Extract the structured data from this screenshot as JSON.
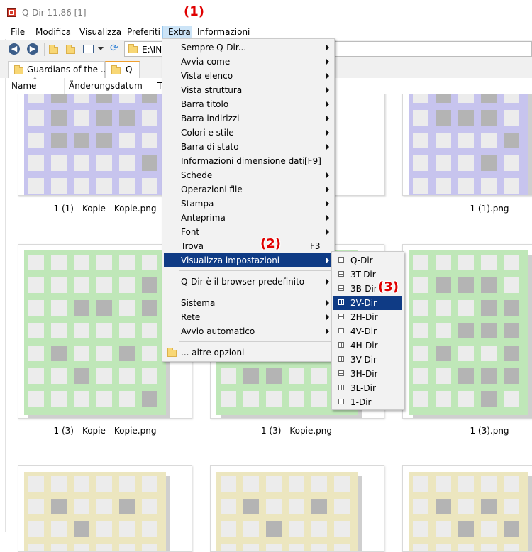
{
  "window": {
    "title": "Q-Dir 11.86 [1]"
  },
  "menubar": {
    "items": [
      "File",
      "Modifica",
      "Visualizza",
      "Preferiti",
      "Extra",
      "Informazioni"
    ]
  },
  "toolbar": {
    "address": "E:\\INE"
  },
  "tabs": [
    {
      "label": "Guardians of the ..."
    },
    {
      "label": "Q"
    }
  ],
  "columns": [
    "Name",
    "Änderungsdatum",
    "Ty"
  ],
  "files": [
    "1 (1) - Kopie - Kopie.png",
    "1 (1).png",
    "1 (3) - Kopie - Kopie.png",
    "1 (3) - Kopie.png",
    "1 (3).png"
  ],
  "extra_menu": {
    "items": [
      "Sempre Q-Dir...",
      "Avvia come",
      "Vista elenco",
      "Vista struttura",
      "Barra titolo",
      "Barra indirizzi",
      "Colori e stile",
      "Barra di stato",
      "Informazioni dimensione dati",
      "Schede",
      "Operazioni file",
      "Stampa",
      "Anteprima",
      "Font",
      "Trova",
      "Visualizza impostazioni",
      "Q-Dir è il browser predefinito",
      "Sistema",
      "Rete",
      "Avvio automatico",
      "... altre opzioni"
    ],
    "shortcuts": {
      "data_size": "[F9]",
      "find": "F3"
    }
  },
  "view_submenu": {
    "items": [
      "Q-Dir",
      "3T-Dir",
      "3B-Dir",
      "2V-Dir",
      "2H-Dir",
      "4V-Dir",
      "4H-Dir",
      "3V-Dir",
      "3H-Dir",
      "3L-Dir",
      "1-Dir"
    ]
  },
  "annotations": [
    "(1)",
    "(2)",
    "(3)"
  ],
  "colors": {
    "accent_highlight": "#0f3b85",
    "annotation": "#e00000",
    "image_purple": "#c7c4ee",
    "image_green": "#bfe7b8",
    "image_yellow": "#ece6bf"
  }
}
